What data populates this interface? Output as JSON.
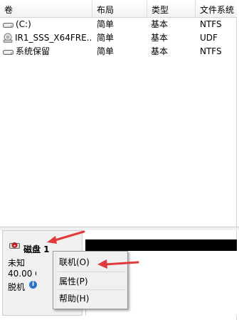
{
  "volume_list": {
    "columns": [
      "卷",
      "布局",
      "类型",
      "文件系统"
    ],
    "rows": [
      {
        "name": "(C:)",
        "layout": "简单",
        "type": "基本",
        "fs": "NTFS",
        "icon": "drive-icon"
      },
      {
        "name": "IR1_SSS_X64FRE...",
        "layout": "简单",
        "type": "基本",
        "fs": "UDF",
        "icon": "optical-drive-icon"
      },
      {
        "name": "系统保留",
        "layout": "简单",
        "type": "基本",
        "fs": "NTFS",
        "icon": "drive-icon"
      }
    ]
  },
  "disk": {
    "title": "磁盘 1",
    "line1": "未知",
    "line2": "40.00 GB",
    "line3": "脱机",
    "icon": "offline-disk-icon"
  },
  "context_menu": {
    "items": [
      "联机(O)",
      "属性(P)",
      "帮助(H)"
    ]
  },
  "colors": {
    "annotation_arrow": "#e23a3a",
    "info_badge": "#2f74c8",
    "partition_bar": "#000000"
  }
}
